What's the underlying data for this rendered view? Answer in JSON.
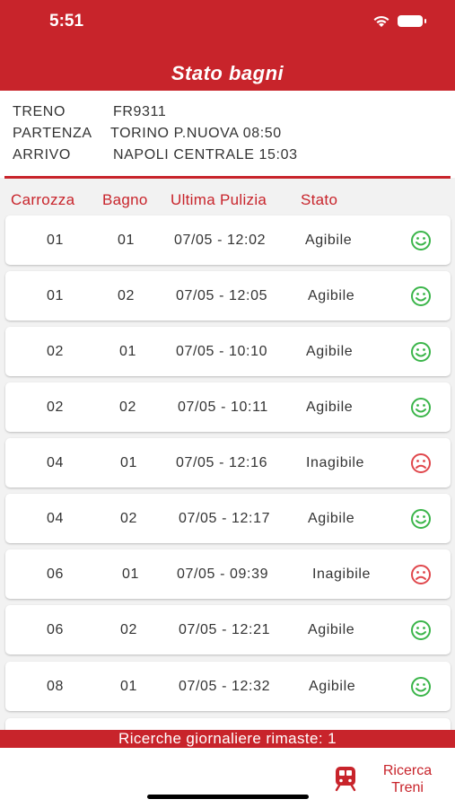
{
  "status_bar": {
    "time": "5:51"
  },
  "header": {
    "title": "Stato bagni"
  },
  "train_info": {
    "train_label": "TRENO",
    "train_value": "FR9311",
    "departure_label": "PARTENZA",
    "departure_value": "TORINO P.NUOVA 08:50",
    "arrival_label": "ARRIVO",
    "arrival_value": "NAPOLI CENTRALE 15:03"
  },
  "columns": {
    "carriage": "Carrozza",
    "bathroom": "Bagno",
    "last_cleaning": "Ultima Pulizia",
    "status": "Stato"
  },
  "rows": [
    {
      "carriage": "01",
      "bathroom": "01",
      "last_cleaning": "07/05 - 12:02",
      "status": "Agibile",
      "icon": "smile-icon"
    },
    {
      "carriage": "01",
      "bathroom": "02",
      "last_cleaning": "07/05 - 12:05",
      "status": "Agibile",
      "icon": "smile-icon"
    },
    {
      "carriage": "02",
      "bathroom": "01",
      "last_cleaning": "07/05 - 10:10",
      "status": "Agibile",
      "icon": "smile-icon"
    },
    {
      "carriage": "02",
      "bathroom": "02",
      "last_cleaning": "07/05 - 10:11",
      "status": "Agibile",
      "icon": "smile-icon"
    },
    {
      "carriage": "04",
      "bathroom": "01",
      "last_cleaning": "07/05 - 12:16",
      "status": "Inagibile",
      "icon": "frown-icon"
    },
    {
      "carriage": "04",
      "bathroom": "02",
      "last_cleaning": "07/05 - 12:17",
      "status": "Agibile",
      "icon": "smile-icon"
    },
    {
      "carriage": "06",
      "bathroom": "01",
      "last_cleaning": "07/05 - 09:39",
      "status": "Inagibile",
      "icon": "frown-icon"
    },
    {
      "carriage": "06",
      "bathroom": "02",
      "last_cleaning": "07/05 - 12:21",
      "status": "Agibile",
      "icon": "smile-icon"
    },
    {
      "carriage": "08",
      "bathroom": "01",
      "last_cleaning": "07/05 - 12:32",
      "status": "Agibile",
      "icon": "smile-icon"
    }
  ],
  "banner": {
    "text": "Ricerche giornaliere rimaste: 1"
  },
  "tab_bar": {
    "search_label_line1": "Ricerca",
    "search_label_line2": "Treni"
  },
  "colors": {
    "brand_red": "#c8242b",
    "ok_green": "#3bb54a",
    "ko_red": "#e0474c"
  }
}
